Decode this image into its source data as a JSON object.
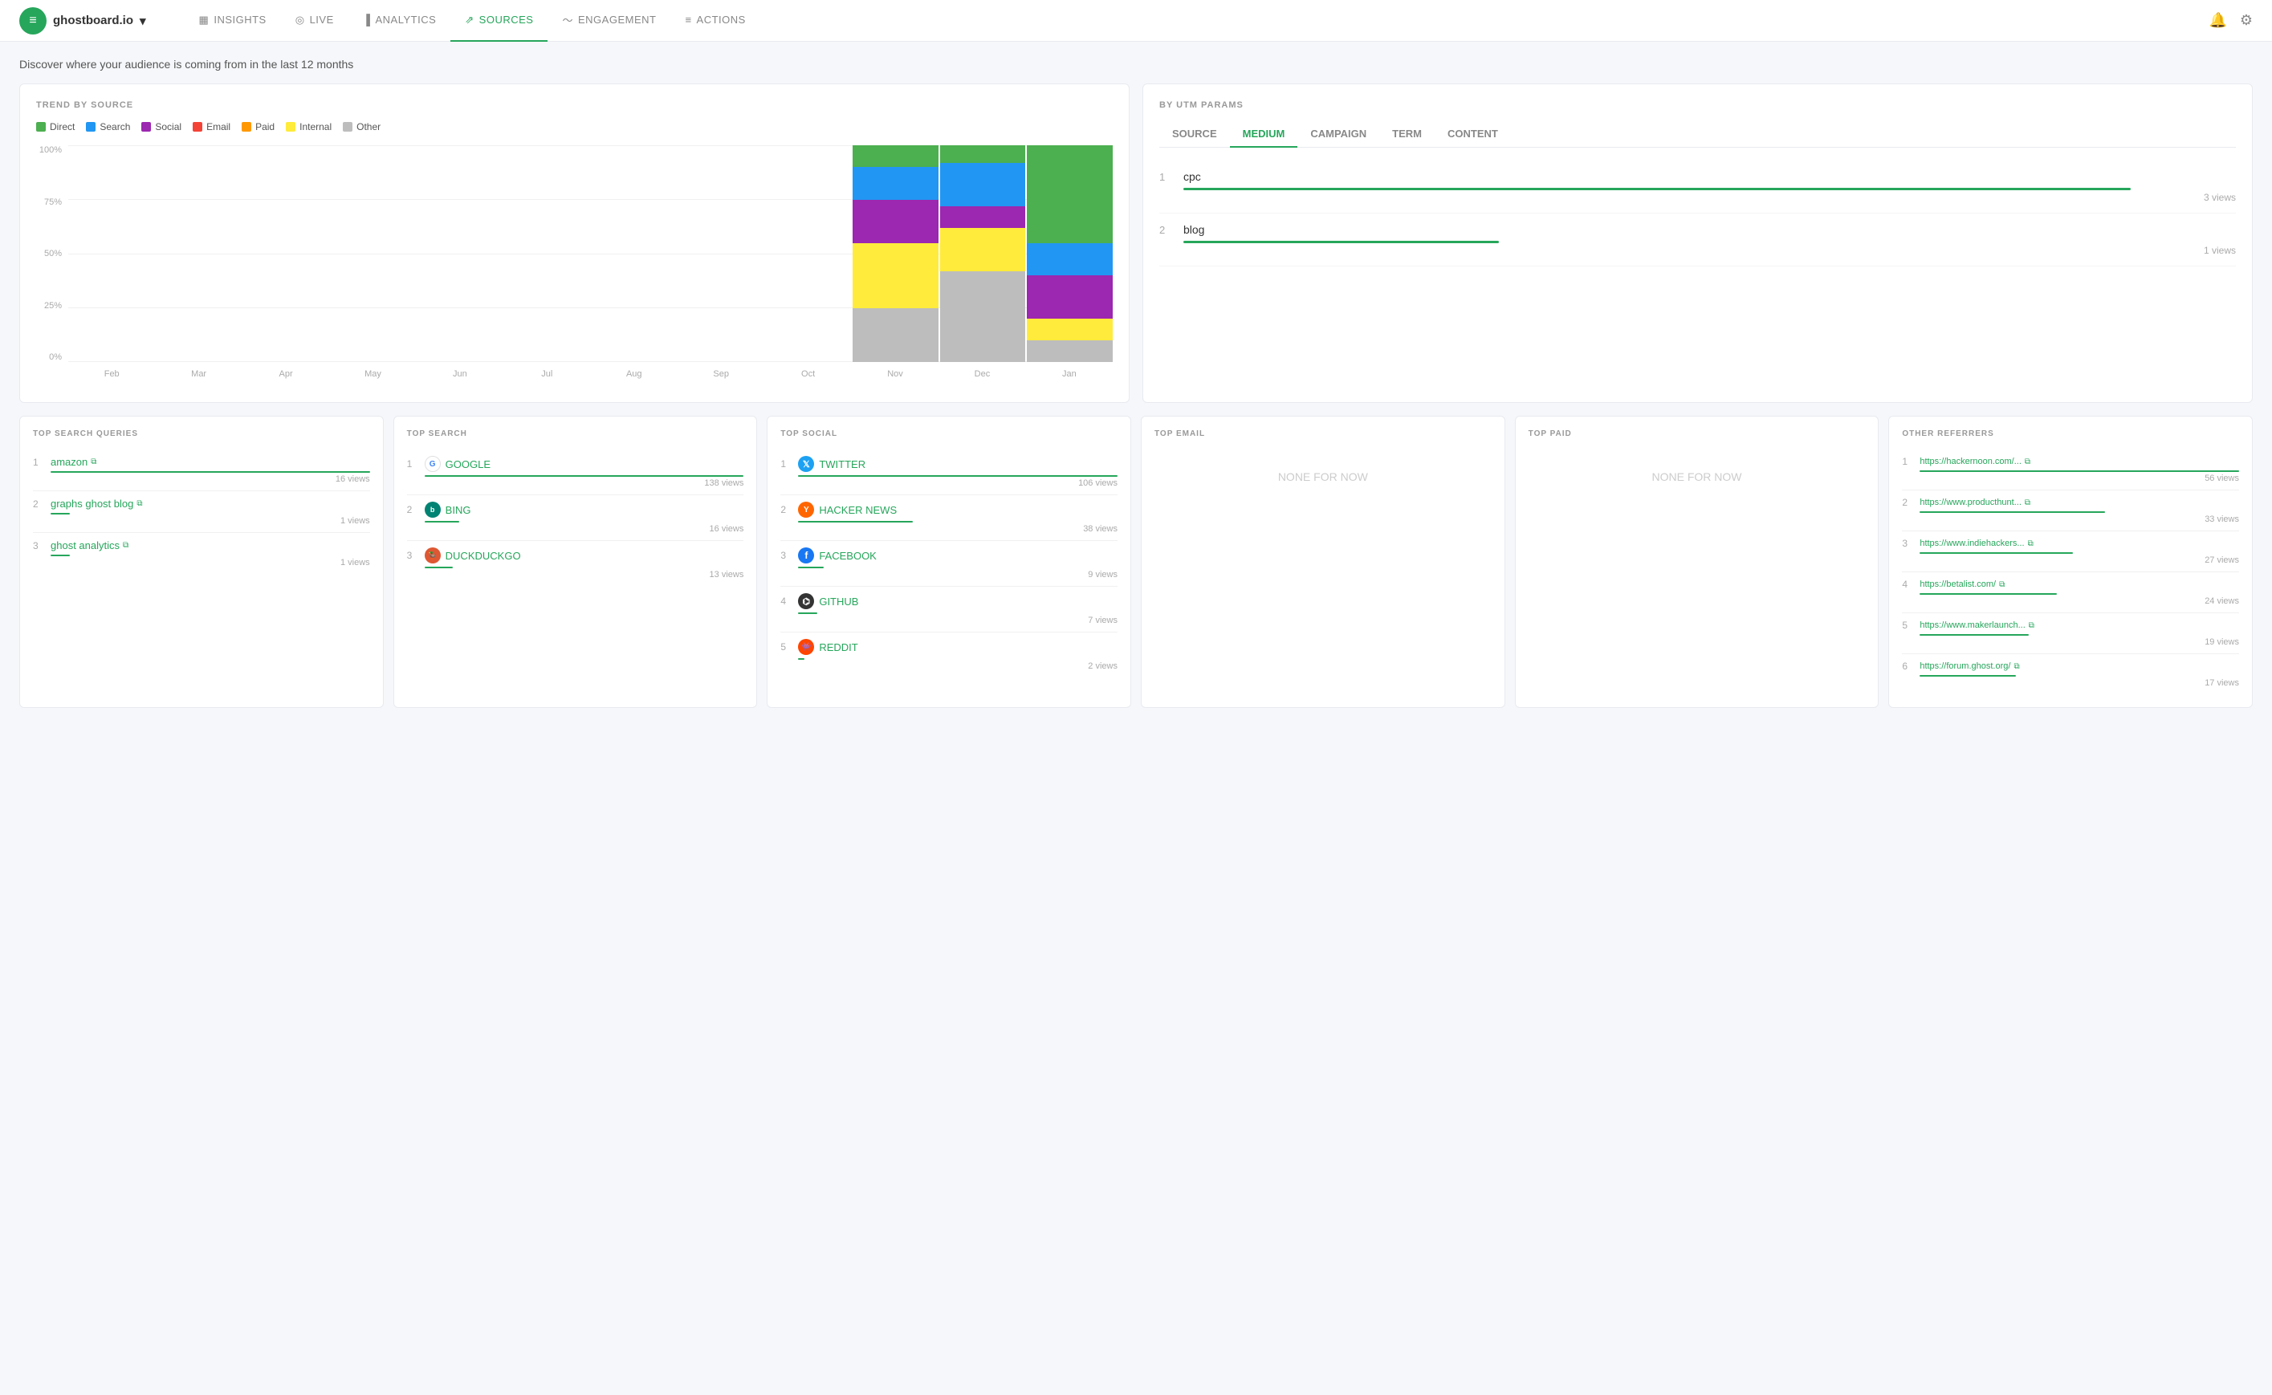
{
  "nav": {
    "brand": "ghostboard.io",
    "chevron": "▾",
    "items": [
      {
        "id": "insights",
        "label": "INSIGHTS",
        "icon": "▦",
        "active": false
      },
      {
        "id": "live",
        "label": "LIVE",
        "icon": "◎",
        "active": false
      },
      {
        "id": "analytics",
        "label": "ANALYTICS",
        "icon": "▐",
        "active": false
      },
      {
        "id": "sources",
        "label": "SOURCES",
        "icon": "⇗",
        "active": true
      },
      {
        "id": "engagement",
        "label": "ENGAGEMENT",
        "icon": "∿",
        "active": false
      },
      {
        "id": "actions",
        "label": "ACTIONS",
        "icon": "≡",
        "active": false
      }
    ]
  },
  "page": {
    "subtitle": "Discover where your audience is coming from in the last 12 months"
  },
  "trend": {
    "title": "TREND BY SOURCE",
    "legend": [
      {
        "label": "Direct",
        "color": "#4caf50"
      },
      {
        "label": "Search",
        "color": "#2196f3"
      },
      {
        "label": "Social",
        "color": "#9c27b0"
      },
      {
        "label": "Email",
        "color": "#f44336"
      },
      {
        "label": "Paid",
        "color": "#ff9800"
      },
      {
        "label": "Internal",
        "color": "#ffeb3b"
      },
      {
        "label": "Other",
        "color": "#bdbdbd"
      }
    ],
    "yLabels": [
      "100%",
      "75%",
      "50%",
      "25%",
      "0%"
    ],
    "xLabels": [
      "Feb",
      "Mar",
      "Apr",
      "May",
      "Jun",
      "Jul",
      "Aug",
      "Sep",
      "Oct",
      "Nov",
      "Dec",
      "Jan"
    ],
    "columns": [
      {
        "month": "Feb",
        "direct": 0,
        "search": 0,
        "social": 0,
        "email": 0,
        "paid": 0,
        "internal": 0,
        "other": 0
      },
      {
        "month": "Mar",
        "direct": 0,
        "search": 0,
        "social": 0,
        "email": 0,
        "paid": 0,
        "internal": 0,
        "other": 0
      },
      {
        "month": "Apr",
        "direct": 0,
        "search": 0,
        "social": 0,
        "email": 0,
        "paid": 0,
        "internal": 0,
        "other": 0
      },
      {
        "month": "May",
        "direct": 0,
        "search": 0,
        "social": 0,
        "email": 0,
        "paid": 0,
        "internal": 0,
        "other": 0
      },
      {
        "month": "Jun",
        "direct": 0,
        "search": 0,
        "social": 0,
        "email": 0,
        "paid": 0,
        "internal": 0,
        "other": 0
      },
      {
        "month": "Jul",
        "direct": 0,
        "search": 0,
        "social": 0,
        "email": 0,
        "paid": 0,
        "internal": 0,
        "other": 0
      },
      {
        "month": "Aug",
        "direct": 0,
        "search": 0,
        "social": 0,
        "email": 0,
        "paid": 0,
        "internal": 0,
        "other": 0
      },
      {
        "month": "Sep",
        "direct": 0,
        "search": 0,
        "social": 0,
        "email": 0,
        "paid": 0,
        "internal": 0,
        "other": 0
      },
      {
        "month": "Oct",
        "direct": 0,
        "search": 0,
        "social": 0,
        "email": 0,
        "paid": 0,
        "internal": 0,
        "other": 0
      },
      {
        "month": "Nov",
        "direct": 10,
        "search": 15,
        "social": 20,
        "email": 0,
        "paid": 0,
        "internal": 30,
        "other": 25
      },
      {
        "month": "Dec",
        "direct": 8,
        "search": 20,
        "social": 10,
        "email": 0,
        "paid": 0,
        "internal": 20,
        "other": 42
      },
      {
        "month": "Jan",
        "direct": 45,
        "search": 15,
        "social": 20,
        "email": 0,
        "paid": 0,
        "internal": 10,
        "other": 10
      }
    ]
  },
  "utm": {
    "title": "BY UTM PARAMS",
    "tabs": [
      "SOURCE",
      "MEDIUM",
      "CAMPAIGN",
      "TERM",
      "CONTENT"
    ],
    "activeTab": "MEDIUM",
    "rows": [
      {
        "num": 1,
        "label": "cpc",
        "views": 3,
        "barWidth": 90
      },
      {
        "num": 2,
        "label": "blog",
        "views": 1,
        "barWidth": 30
      }
    ]
  },
  "topSearchQueries": {
    "title": "TOP SEARCH QUERIES",
    "items": [
      {
        "num": 1,
        "label": "amazon",
        "views": 16,
        "barWidth": 100
      },
      {
        "num": 2,
        "label": "graphs ghost blog",
        "views": 1,
        "barWidth": 6
      },
      {
        "num": 3,
        "label": "ghost analytics",
        "views": 1,
        "barWidth": 6
      }
    ]
  },
  "topSearch": {
    "title": "TOP SEARCH",
    "items": [
      {
        "num": 1,
        "label": "GOOGLE",
        "icon": "google",
        "views": 138,
        "barWidth": 100
      },
      {
        "num": 2,
        "label": "BING",
        "icon": "bing",
        "views": 16,
        "barWidth": 11
      },
      {
        "num": 3,
        "label": "DUCKDUCKGO",
        "icon": "ddg",
        "views": 13,
        "barWidth": 9
      }
    ]
  },
  "topSocial": {
    "title": "TOP SOCIAL",
    "items": [
      {
        "num": 1,
        "label": "TWITTER",
        "icon": "twitter",
        "views": 106,
        "barWidth": 100
      },
      {
        "num": 2,
        "label": "HACKER NEWS",
        "icon": "hn",
        "views": 38,
        "barWidth": 36
      },
      {
        "num": 3,
        "label": "FACEBOOK",
        "icon": "facebook",
        "views": 9,
        "barWidth": 8
      },
      {
        "num": 4,
        "label": "GITHUB",
        "icon": "github",
        "views": 7,
        "barWidth": 6
      },
      {
        "num": 5,
        "label": "REDDIT",
        "icon": "reddit",
        "views": 2,
        "barWidth": 2
      }
    ]
  },
  "topEmail": {
    "title": "TOP EMAIL",
    "noneMsg": "NONE FOR NOW"
  },
  "topPaid": {
    "title": "TOP PAID",
    "noneMsg": "NONE FOR NOW"
  },
  "otherReferrers": {
    "title": "OTHER REFERRERS",
    "items": [
      {
        "num": 1,
        "label": "https://hackernoon.com/...",
        "views": 56,
        "barWidth": 100
      },
      {
        "num": 2,
        "label": "https://www.producthunt...",
        "views": 33,
        "barWidth": 58
      },
      {
        "num": 3,
        "label": "https://www.indiehackers...",
        "views": 27,
        "barWidth": 48
      },
      {
        "num": 4,
        "label": "https://betalist.com/",
        "views": 24,
        "barWidth": 43
      },
      {
        "num": 5,
        "label": "https://www.makerlaunch...",
        "views": 19,
        "barWidth": 34
      },
      {
        "num": 6,
        "label": "https://forum.ghost.org/",
        "views": 17,
        "barWidth": 30
      }
    ]
  }
}
